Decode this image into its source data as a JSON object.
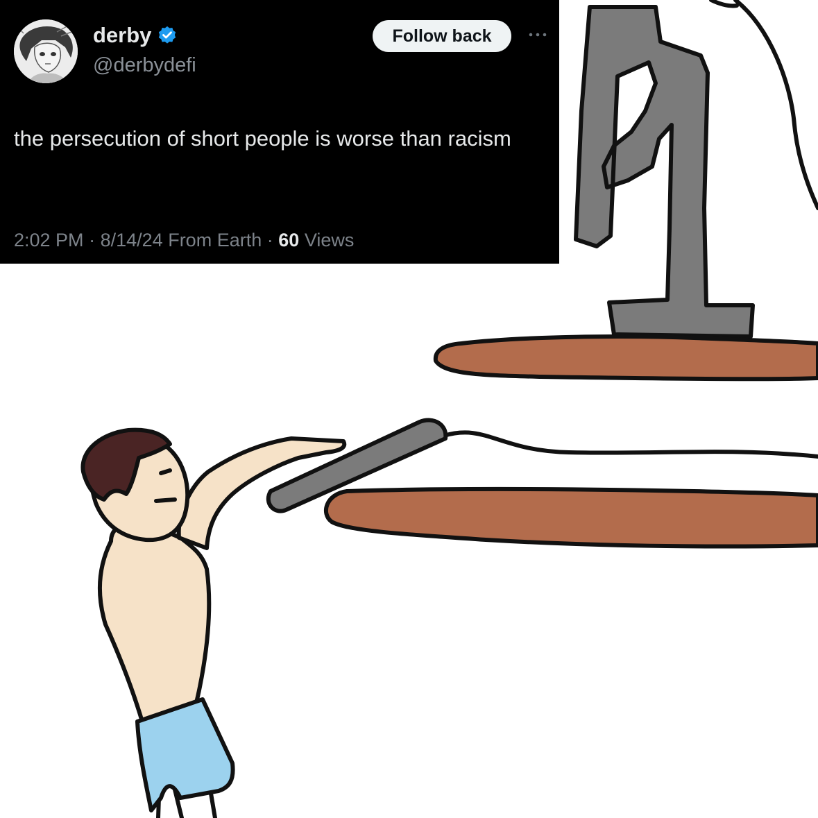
{
  "tweet": {
    "display_name": "derby",
    "handle": "@derbydefi",
    "follow_label": "Follow back",
    "text": "the persecution of short people is worse than racism",
    "time": "2:02 PM",
    "date": "8/14/24",
    "source": "From Earth",
    "views_count": "60",
    "views_label": "Views",
    "separator": "·",
    "avatar_icon": "anime-avatar-icon",
    "verified_icon": "verified-badge-icon",
    "more_icon": "more-options-icon",
    "verified_color": "#1d9bf0"
  },
  "illustration": {
    "subject": "cartoon boy reaching up toward a keyboard below a computer monitor on shelves",
    "colors": {
      "shelf": "#b36c4c",
      "monitor": "#7b7b7b",
      "skin": "#f6e2c8",
      "hair": "#4a2424",
      "shorts": "#9cd2ee"
    }
  }
}
